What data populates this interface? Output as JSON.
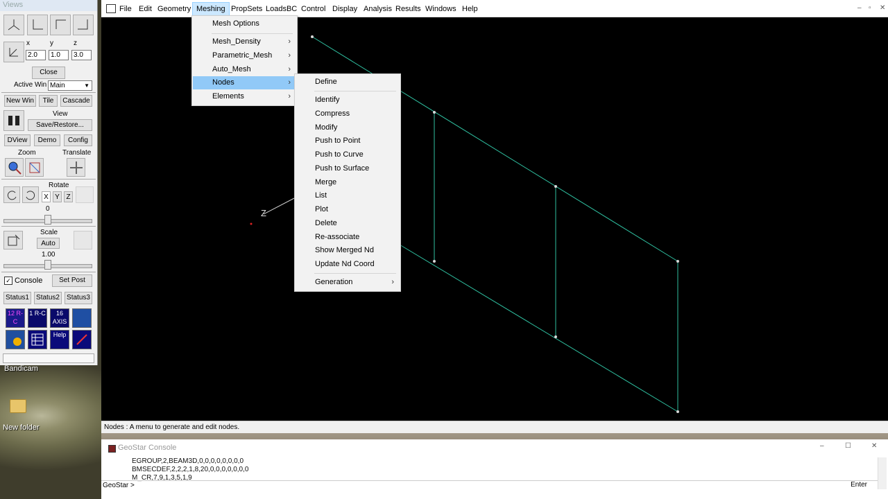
{
  "views": {
    "title": "Views",
    "coord_labels": [
      "x",
      "y",
      "z"
    ],
    "coord_values": [
      "2.0",
      "1.0",
      "3.0"
    ],
    "close": "Close",
    "active_win_label": "Active Win",
    "active_win_value": "Main",
    "new_win": "New Win",
    "tile": "Tile",
    "cascade": "Cascade",
    "view_label": "View",
    "save_restore": "Save/Restore...",
    "dview": "DView",
    "demo": "Demo",
    "config": "Config",
    "zoom": "Zoom",
    "translate": "Translate",
    "rotate": "Rotate",
    "axes": [
      "X",
      "Y",
      "Z"
    ],
    "rotate_value": "0",
    "scale": "Scale",
    "auto": "Auto",
    "scale_value": "1.00",
    "console": "Console",
    "set_post": "Set Post",
    "status1": "Status1",
    "status2": "Status2",
    "status3": "Status3",
    "toolbox_labels": [
      "12 R-C",
      "1 R-C",
      "16 AXIS",
      "",
      "",
      "",
      "Help",
      ""
    ]
  },
  "desktop": {
    "bandicam": "Bandicam",
    "new_folder": "New folder"
  },
  "menubar": {
    "items": [
      "File",
      "Edit",
      "Geometry",
      "Meshing",
      "PropSets",
      "LoadsBC",
      "Control",
      "Display",
      "Analysis",
      "Results",
      "Windows",
      "Help"
    ],
    "active": "Meshing"
  },
  "meshing_menu": {
    "items": [
      "Mesh Options",
      "Mesh_Density",
      "Parametric_Mesh",
      "Auto_Mesh",
      "Nodes",
      "Elements"
    ],
    "highlighted": "Nodes"
  },
  "nodes_menu": {
    "items": [
      "Define",
      "Identify",
      "Compress",
      "Modify",
      "Push to Point",
      "Push to Curve",
      "Push to Surface",
      "Merge",
      "List",
      "Plot",
      "Delete",
      "Re-associate",
      "Show Merged Nd",
      "Update Nd Coord",
      "Generation"
    ]
  },
  "canvas": {
    "axis_label": "Z",
    "line_color": "#2fbfa0",
    "node_color": "#d8d8d8"
  },
  "status_text": "Nodes : A menu to generate and edit nodes.",
  "console": {
    "title": "GeoStar Console",
    "lines": [
      "EGROUP,2,BEAM3D,0,0,0,0,0,0,0,0",
      "BMSECDEF,2,2,2,1,8,20,0,0,0,0,0,0,0",
      "M_CR,7,9,1,3,5,1,9"
    ],
    "prompt": "GeoStar >",
    "enter": "Enter"
  }
}
